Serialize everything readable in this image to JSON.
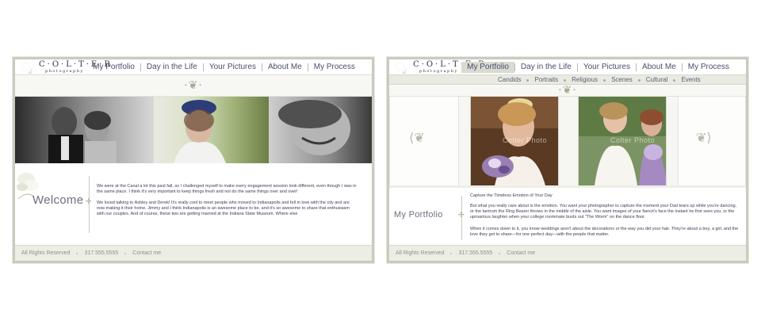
{
  "left": {
    "logo": {
      "main": "C·O·L·T·E·R",
      "sub": "photography",
      "swirl": "ೃ"
    },
    "nav": [
      {
        "label": "My Portfolio"
      },
      {
        "label": "Day in the Life"
      },
      {
        "label": "Your Pictures"
      },
      {
        "label": "About Me"
      },
      {
        "label": "My Process"
      }
    ],
    "ornament": "·❦·",
    "section_title": "Welcome",
    "paragraphs": [
      "We were at the Canal a lot this past fall, so I challenged myself to make every engagement session look different, even though I was in the same place. I think it's very important to keep things fresh and not do the same things over and over!",
      "We loved talking to Ashley and Derek! It's really cool to meet people who moved to Indianapolis and fell in love with the city and are now making it their home. Jimmy and I think Indianapolis is an awesome place to be, and it's so awesome to share that enthusiasm with our couples. And of course, these two are getting married at the Indiana State Museum. Where else"
    ],
    "footer": {
      "rights": "All Rights Reserved",
      "phone": "317.555.5555",
      "contact": "Contact me"
    }
  },
  "right": {
    "logo": {
      "main": "C·O·L·T·E·R",
      "sub": "photography",
      "swirl": "ೃ"
    },
    "nav": [
      {
        "label": "My Portfolio",
        "active": true
      },
      {
        "label": "Day in the Life"
      },
      {
        "label": "Your Pictures"
      },
      {
        "label": "About Me"
      },
      {
        "label": "My Process"
      }
    ],
    "subnav": [
      {
        "label": "Candids"
      },
      {
        "label": "Portraits"
      },
      {
        "label": "Religious"
      },
      {
        "label": "Scenes"
      },
      {
        "label": "Cultural"
      },
      {
        "label": "Events"
      }
    ],
    "ornament": "·❦·",
    "watermark_1": "Colter Photo",
    "watermark_2": "Colter Photo",
    "section_title": "My Portfolio",
    "paragraphs": [
      "Capture the Timeless Emotion of Your Day",
      "But what you really care about is the emotion. You want your photographer to capture the moment your Dad tears up while you're dancing, or the tantrum the Ring Bearer throws in the middle of the aisle. You want images of your fiancé's face the instant he first sees you, or the uproarious laughter when your college roommate busts out \"The Worm\" on the dance floor.",
      "When it comes down to it, you know weddings aren't about the decorations or the way you did your hair. They're about a boy, a girl, and the love they get to share—for one perfect day—with the people that matter."
    ],
    "footer": {
      "rights": "All Rights Reserved",
      "phone": "317.555.5555",
      "contact": "Contact me"
    }
  }
}
